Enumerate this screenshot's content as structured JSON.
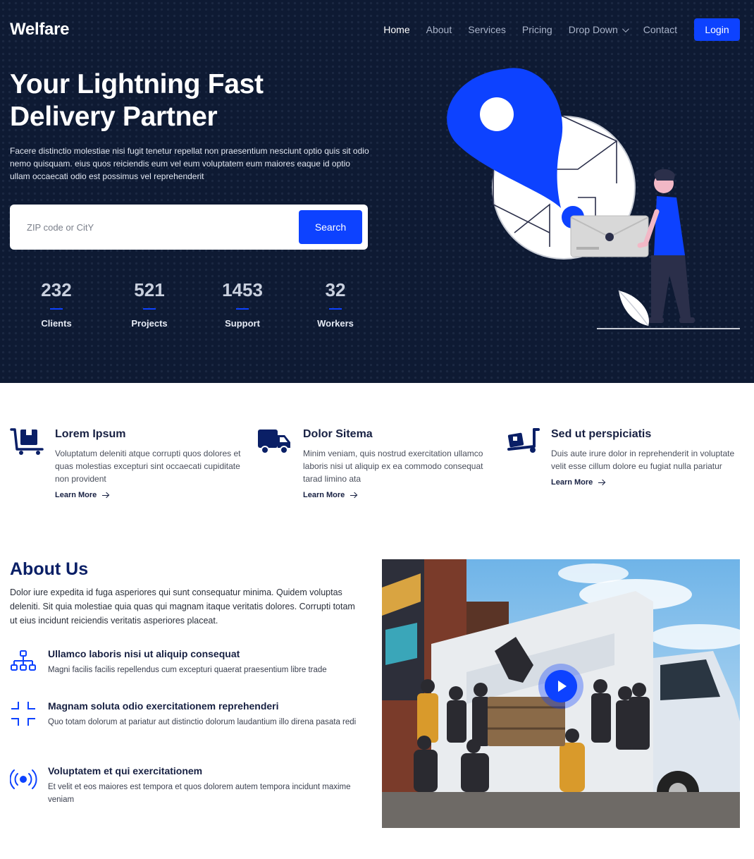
{
  "brand": {
    "name": "Welfare"
  },
  "nav": {
    "items": [
      {
        "label": "Home"
      },
      {
        "label": "About"
      },
      {
        "label": "Services"
      },
      {
        "label": "Pricing"
      },
      {
        "label": "Drop Down"
      },
      {
        "label": "Contact"
      }
    ],
    "login_label": "Login"
  },
  "hero": {
    "title": "Your Lightning Fast Delivery Partner",
    "description": "Facere distinctio molestiae nisi fugit tenetur repellat non praesentium nesciunt optio quis sit odio nemo quisquam. eius quos reiciendis eum vel eum voluptatem eum maiores eaque id optio ullam occaecati odio est possimus vel reprehenderit",
    "search": {
      "placeholder": "ZIP code or CitY",
      "button_label": "Search"
    },
    "stats": [
      {
        "value": "232",
        "label": "Clients"
      },
      {
        "value": "521",
        "label": "Projects"
      },
      {
        "value": "1453",
        "label": "Support"
      },
      {
        "value": "32",
        "label": "Workers"
      }
    ]
  },
  "services": [
    {
      "icon": "cart-boxes-icon",
      "title": "Lorem Ipsum",
      "text": "Voluptatum deleniti atque corrupti quos dolores et quas molestias excepturi sint occaecati cupiditate non provident",
      "link": "Learn More"
    },
    {
      "icon": "truck-icon",
      "title": "Dolor Sitema",
      "text": "Minim veniam, quis nostrud exercitation ullamco laboris nisi ut aliquip ex ea commodo consequat tarad limino ata",
      "link": "Learn More"
    },
    {
      "icon": "hand-truck-icon",
      "title": "Sed ut perspiciatis",
      "text": "Duis aute irure dolor in reprehenderit in voluptate velit esse cillum dolore eu fugiat nulla pariatur",
      "link": "Learn More"
    }
  ],
  "about": {
    "title": "About Us",
    "description": "Dolor iure expedita id fuga asperiores qui sunt consequatur minima. Quidem voluptas deleniti. Sit quia molestiae quia quas qui magnam itaque veritatis dolores. Corrupti totam ut eius incidunt reiciendis veritatis asperiores placeat.",
    "features": [
      {
        "icon": "diagram-icon",
        "title": "Ullamco laboris nisi ut aliquip consequat",
        "text": "Magni facilis facilis repellendus cum excepturi quaerat praesentium libre trade"
      },
      {
        "icon": "focus-icon",
        "title": "Magnam soluta odio exercitationem reprehenderi",
        "text": "Quo totam dolorum at pariatur aut distinctio dolorum laudantium illo direna pasata redi"
      },
      {
        "icon": "broadcast-icon",
        "title": "Voluptatem et qui exercitationem",
        "text": "Et velit et eos maiores est tempora et quos dolorem autem tempora incidunt maxime veniam"
      }
    ]
  },
  "colors": {
    "accent": "#0d42ff",
    "hero_bg": "#0e1a33",
    "heading": "#0a1f66"
  }
}
